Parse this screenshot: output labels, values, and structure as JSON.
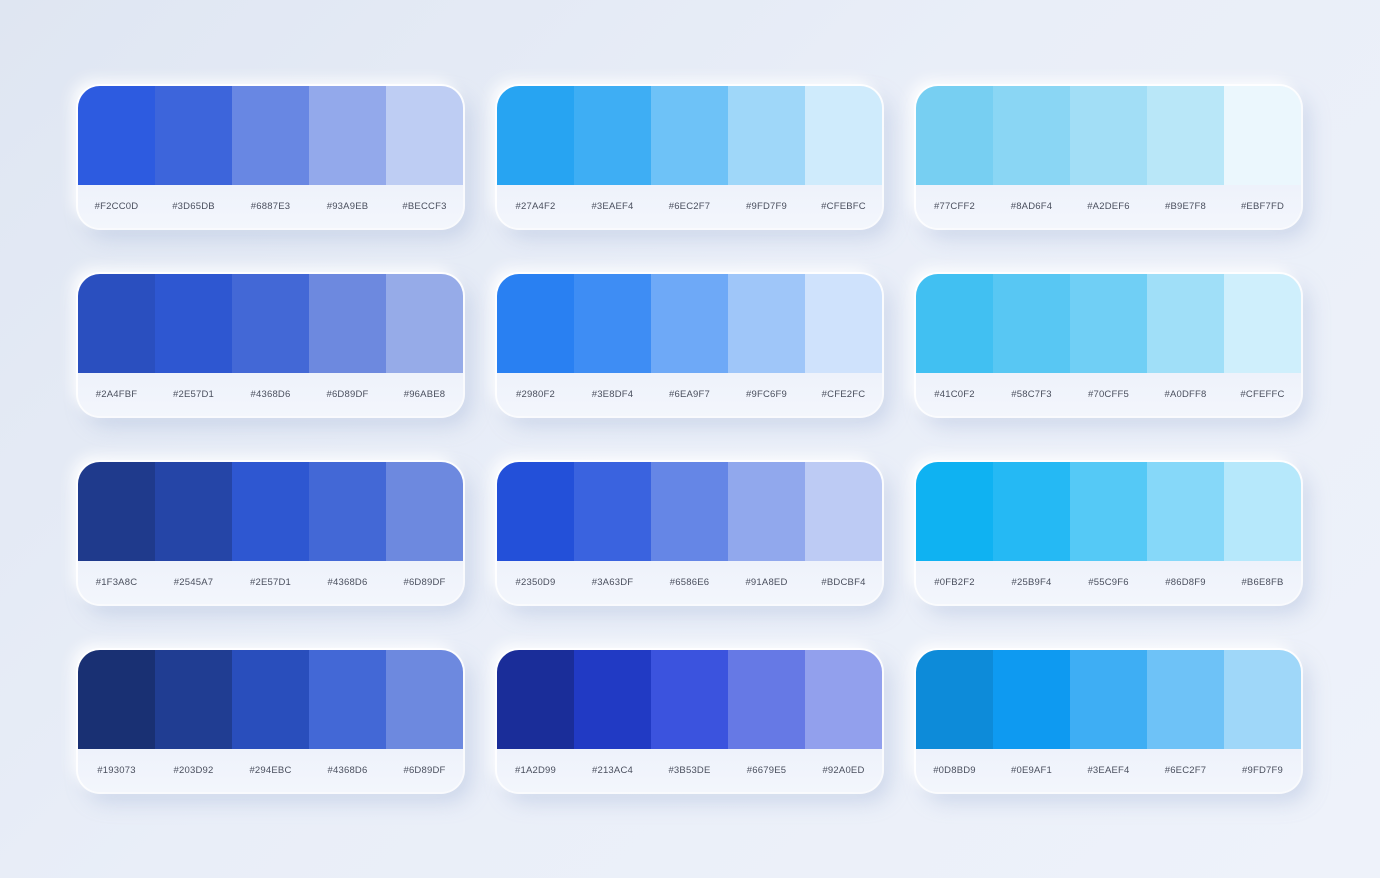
{
  "palettes": [
    {
      "colors": [
        "#2d5be0",
        "#3d65db",
        "#6887e3",
        "#93a9eb",
        "#becdf3"
      ],
      "labels": [
        "#F2CC0D",
        "#3D65DB",
        "#6887E3",
        "#93A9EB",
        "#BECCF3"
      ]
    },
    {
      "colors": [
        "#27a4f2",
        "#3eaef4",
        "#6ec2f7",
        "#9fd7f9",
        "#cfebfc"
      ],
      "labels": [
        "#27A4F2",
        "#3EAEF4",
        "#6EC2F7",
        "#9FD7F9",
        "#CFEBFC"
      ]
    },
    {
      "colors": [
        "#77cff2",
        "#8ad6f4",
        "#a2def6",
        "#b9e7f8",
        "#ebf7fd"
      ],
      "labels": [
        "#77CFF2",
        "#8AD6F4",
        "#A2DEF6",
        "#B9E7F8",
        "#EBF7FD"
      ]
    },
    {
      "colors": [
        "#2a4fbf",
        "#2e57d1",
        "#4368d6",
        "#6d89df",
        "#96abe8"
      ],
      "labels": [
        "#2A4FBF",
        "#2E57D1",
        "#4368D6",
        "#6D89DF",
        "#96ABE8"
      ]
    },
    {
      "colors": [
        "#2980f2",
        "#3e8df4",
        "#6ea9f7",
        "#9fc6f9",
        "#cfe2fc"
      ],
      "labels": [
        "#2980F2",
        "#3E8DF4",
        "#6EA9F7",
        "#9FC6F9",
        "#CFE2FC"
      ]
    },
    {
      "colors": [
        "#41c0f2",
        "#58c7f3",
        "#70cff5",
        "#a0dff8",
        "#cfeffc"
      ],
      "labels": [
        "#41C0F2",
        "#58C7F3",
        "#70CFF5",
        "#A0DFF8",
        "#CFEFFC"
      ]
    },
    {
      "colors": [
        "#1f3a8c",
        "#2545a7",
        "#2e57d1",
        "#4368d6",
        "#6d89df"
      ],
      "labels": [
        "#1F3A8C",
        "#2545A7",
        "#2E57D1",
        "#4368D6",
        "#6D89DF"
      ]
    },
    {
      "colors": [
        "#2350d9",
        "#3a63df",
        "#6586e6",
        "#91a8ed",
        "#bdcbf4"
      ],
      "labels": [
        "#2350D9",
        "#3A63DF",
        "#6586E6",
        "#91A8ED",
        "#BDCBF4"
      ]
    },
    {
      "colors": [
        "#0fb2f2",
        "#25b9f4",
        "#55c9f6",
        "#86d8f9",
        "#b6e8fb"
      ],
      "labels": [
        "#0FB2F2",
        "#25B9F4",
        "#55C9F6",
        "#86D8F9",
        "#B6E8FB"
      ]
    },
    {
      "colors": [
        "#193073",
        "#203d92",
        "#294ebc",
        "#4368d6",
        "#6d89df"
      ],
      "labels": [
        "#193073",
        "#203D92",
        "#294EBC",
        "#4368D6",
        "#6D89DF"
      ]
    },
    {
      "colors": [
        "#1a2d99",
        "#213ac4",
        "#3b53de",
        "#6679e5",
        "#92a0ed"
      ],
      "labels": [
        "#1A2D99",
        "#213AC4",
        "#3B53DE",
        "#6679E5",
        "#92A0ED"
      ]
    },
    {
      "colors": [
        "#0d8bd9",
        "#0e9af1",
        "#3eaef4",
        "#6ec2f7",
        "#9fd7f9"
      ],
      "labels": [
        "#0D8BD9",
        "#0E9AF1",
        "#3EAEF4",
        "#6EC2F7",
        "#9FD7F9"
      ]
    }
  ]
}
